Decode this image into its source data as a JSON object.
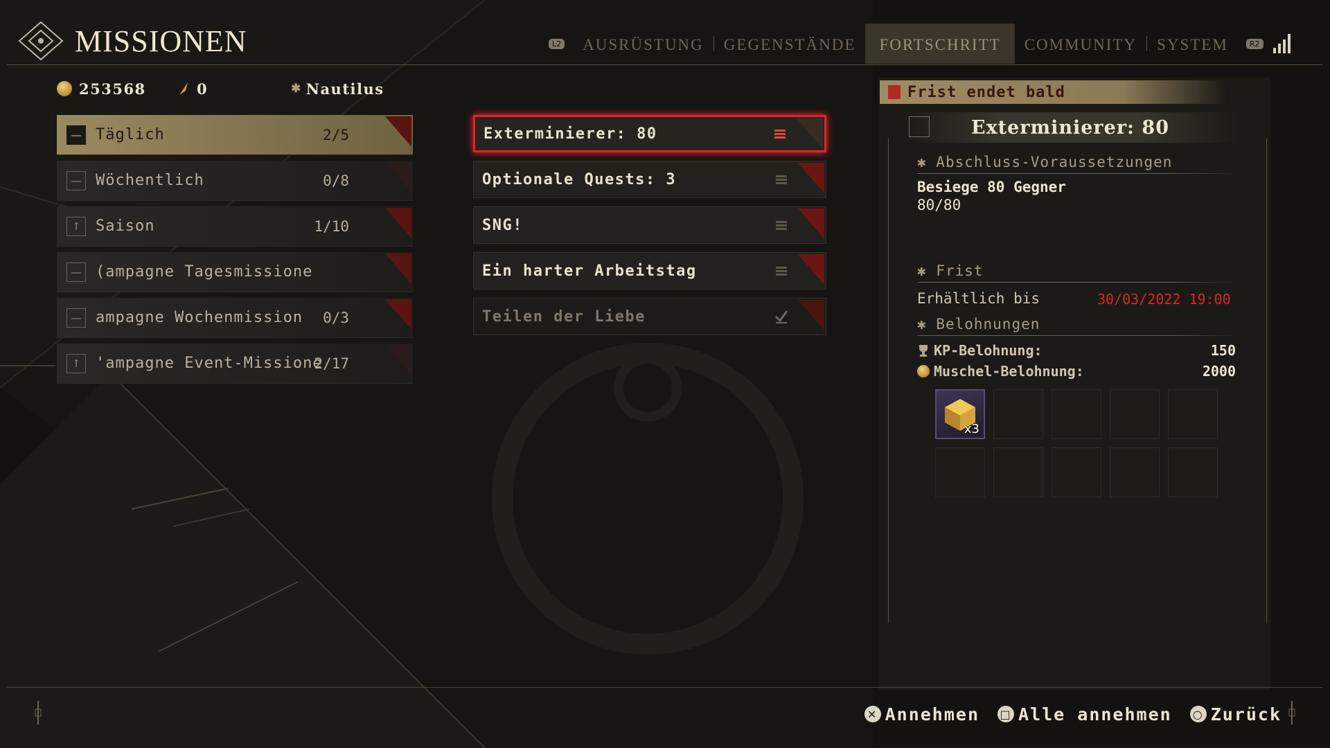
{
  "header": {
    "title": "MISSIONEN",
    "nav_left_badge": "L2",
    "nav_right_badge": "R2",
    "tabs": [
      {
        "label": "AUSRÜSTUNG",
        "active": false
      },
      {
        "label": "GEGENSTÄNDE",
        "active": false
      },
      {
        "label": "FORTSCHRITT",
        "active": true
      },
      {
        "label": "COMMUNITY",
        "active": false
      },
      {
        "label": "SYSTEM",
        "active": false
      }
    ],
    "signal_icon": "signal-bars-icon"
  },
  "currency": {
    "shells": "253568",
    "tokens": "0",
    "ship_name": "Nautilus"
  },
  "categories": [
    {
      "label": "Täglich",
      "count": "2/5",
      "active": true
    },
    {
      "label": "Wöchentlich",
      "count": "0/8",
      "active": false
    },
    {
      "label": "Saison",
      "count": "1/10",
      "active": false
    },
    {
      "label": "(ampagne Tagesmissione",
      "count": "",
      "active": false
    },
    {
      "label": "ampagne Wochenmission",
      "count": "0/3",
      "active": false
    },
    {
      "label": "'ampagne Event-Missione",
      "count": "2/17",
      "active": false
    }
  ],
  "missions": [
    {
      "label": "Exterminierer: 80",
      "selected": true,
      "completed": false
    },
    {
      "label": "Optionale Quests: 3",
      "selected": false,
      "completed": false
    },
    {
      "label": "SNG!",
      "selected": false,
      "completed": false
    },
    {
      "label": "Ein harter Arbeitstag",
      "selected": false,
      "completed": false
    },
    {
      "label": "Teilen der Liebe",
      "selected": false,
      "completed": true
    }
  ],
  "detail": {
    "deadline_banner": "Frist endet bald",
    "title": "Exterminierer: 80",
    "requirements_head": "Abschluss-Voraussetzungen",
    "requirement": "Besiege 80 Gegner",
    "progress": "80/80",
    "deadline_head": "Frist",
    "available_label": "Erhältlich bis",
    "available_date": "30/03/2022  19:00",
    "rewards_head": "Belohnungen",
    "kp_label": "KP-Belohnung:",
    "kp_value": "150",
    "shell_label": "Muschel-Belohnung:",
    "shell_value": "2000",
    "reward_item_qty": "x3"
  },
  "footer": {
    "accept": "Annehmen",
    "accept_all": "Alle annehmen",
    "back": "Zurück"
  },
  "colors": {
    "accent_red": "#e0232a",
    "gold": "#9b8a5f",
    "date_red": "#d8262c"
  }
}
